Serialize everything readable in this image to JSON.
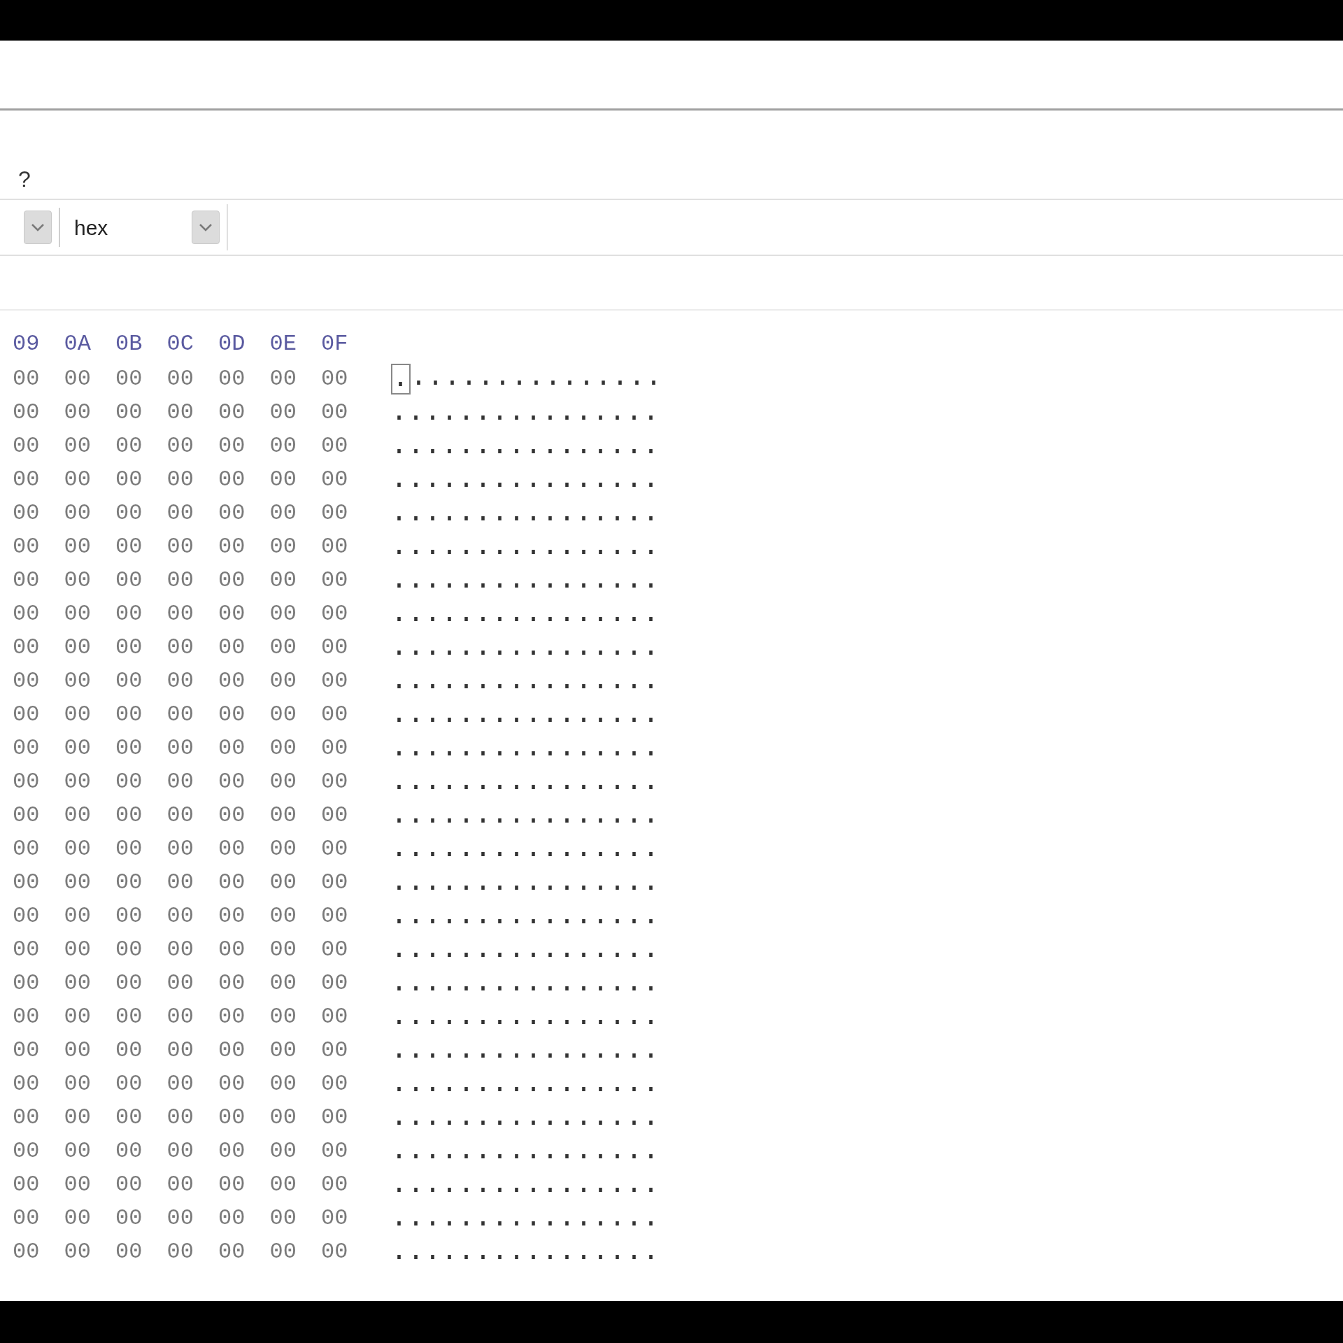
{
  "help_mark": "?",
  "toolbar": {
    "format_dropdown": {
      "value": "hex"
    }
  },
  "hex_view": {
    "columns": [
      "09",
      "0A",
      "0B",
      "0C",
      "0D",
      "0E",
      "0F"
    ],
    "rows": [
      {
        "cells": [
          "00",
          "00",
          "00",
          "00",
          "00",
          "00",
          "00"
        ],
        "ascii": "................",
        "cursor": true
      },
      {
        "cells": [
          "00",
          "00",
          "00",
          "00",
          "00",
          "00",
          "00"
        ],
        "ascii": "................",
        "cursor": false
      },
      {
        "cells": [
          "00",
          "00",
          "00",
          "00",
          "00",
          "00",
          "00"
        ],
        "ascii": "................",
        "cursor": false
      },
      {
        "cells": [
          "00",
          "00",
          "00",
          "00",
          "00",
          "00",
          "00"
        ],
        "ascii": "................",
        "cursor": false
      },
      {
        "cells": [
          "00",
          "00",
          "00",
          "00",
          "00",
          "00",
          "00"
        ],
        "ascii": "................",
        "cursor": false
      },
      {
        "cells": [
          "00",
          "00",
          "00",
          "00",
          "00",
          "00",
          "00"
        ],
        "ascii": "................",
        "cursor": false
      },
      {
        "cells": [
          "00",
          "00",
          "00",
          "00",
          "00",
          "00",
          "00"
        ],
        "ascii": "................",
        "cursor": false
      },
      {
        "cells": [
          "00",
          "00",
          "00",
          "00",
          "00",
          "00",
          "00"
        ],
        "ascii": "................",
        "cursor": false
      },
      {
        "cells": [
          "00",
          "00",
          "00",
          "00",
          "00",
          "00",
          "00"
        ],
        "ascii": "................",
        "cursor": false
      },
      {
        "cells": [
          "00",
          "00",
          "00",
          "00",
          "00",
          "00",
          "00"
        ],
        "ascii": "................",
        "cursor": false
      },
      {
        "cells": [
          "00",
          "00",
          "00",
          "00",
          "00",
          "00",
          "00"
        ],
        "ascii": "................",
        "cursor": false
      },
      {
        "cells": [
          "00",
          "00",
          "00",
          "00",
          "00",
          "00",
          "00"
        ],
        "ascii": "................",
        "cursor": false
      },
      {
        "cells": [
          "00",
          "00",
          "00",
          "00",
          "00",
          "00",
          "00"
        ],
        "ascii": "................",
        "cursor": false
      },
      {
        "cells": [
          "00",
          "00",
          "00",
          "00",
          "00",
          "00",
          "00"
        ],
        "ascii": "................",
        "cursor": false
      },
      {
        "cells": [
          "00",
          "00",
          "00",
          "00",
          "00",
          "00",
          "00"
        ],
        "ascii": "................",
        "cursor": false
      },
      {
        "cells": [
          "00",
          "00",
          "00",
          "00",
          "00",
          "00",
          "00"
        ],
        "ascii": "................",
        "cursor": false
      },
      {
        "cells": [
          "00",
          "00",
          "00",
          "00",
          "00",
          "00",
          "00"
        ],
        "ascii": "................",
        "cursor": false
      },
      {
        "cells": [
          "00",
          "00",
          "00",
          "00",
          "00",
          "00",
          "00"
        ],
        "ascii": "................",
        "cursor": false
      },
      {
        "cells": [
          "00",
          "00",
          "00",
          "00",
          "00",
          "00",
          "00"
        ],
        "ascii": "................",
        "cursor": false
      },
      {
        "cells": [
          "00",
          "00",
          "00",
          "00",
          "00",
          "00",
          "00"
        ],
        "ascii": "................",
        "cursor": false
      },
      {
        "cells": [
          "00",
          "00",
          "00",
          "00",
          "00",
          "00",
          "00"
        ],
        "ascii": "................",
        "cursor": false
      },
      {
        "cells": [
          "00",
          "00",
          "00",
          "00",
          "00",
          "00",
          "00"
        ],
        "ascii": "................",
        "cursor": false
      },
      {
        "cells": [
          "00",
          "00",
          "00",
          "00",
          "00",
          "00",
          "00"
        ],
        "ascii": "................",
        "cursor": false
      },
      {
        "cells": [
          "00",
          "00",
          "00",
          "00",
          "00",
          "00",
          "00"
        ],
        "ascii": "................",
        "cursor": false
      },
      {
        "cells": [
          "00",
          "00",
          "00",
          "00",
          "00",
          "00",
          "00"
        ],
        "ascii": "................",
        "cursor": false
      },
      {
        "cells": [
          "00",
          "00",
          "00",
          "00",
          "00",
          "00",
          "00"
        ],
        "ascii": "................",
        "cursor": false
      },
      {
        "cells": [
          "00",
          "00",
          "00",
          "00",
          "00",
          "00",
          "00"
        ],
        "ascii": "................",
        "cursor": false
      }
    ]
  }
}
